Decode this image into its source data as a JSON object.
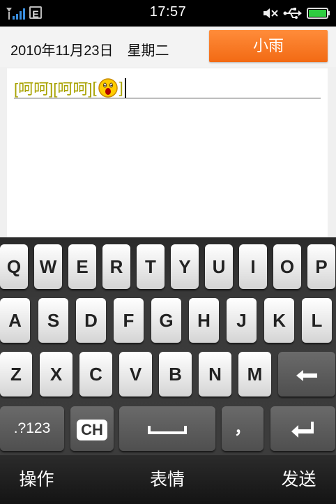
{
  "status_bar": {
    "time": "17:57",
    "network_label": "E",
    "icons": [
      "signal-icon",
      "network-e-icon",
      "mute-icon",
      "usb-icon",
      "battery-icon"
    ],
    "battery_color": "#2ecc40"
  },
  "header": {
    "date": "2010年11月23日　星期二",
    "recipient": "小雨",
    "recipient_color": "#f26a14"
  },
  "compose": {
    "tokens": [
      "[呵呵]",
      "[呵呵]",
      "["
    ],
    "trailing_bracket": "]",
    "emoji": "surprised-face-emoji",
    "text_color": "#a8a200"
  },
  "keyboard": {
    "row1": [
      "Q",
      "W",
      "E",
      "R",
      "T",
      "Y",
      "U",
      "I",
      "O",
      "P"
    ],
    "row2": [
      "A",
      "S",
      "D",
      "F",
      "G",
      "H",
      "J",
      "K",
      "L"
    ],
    "row3": [
      "Z",
      "X",
      "C",
      "V",
      "B",
      "N",
      "M"
    ],
    "backspace_icon": "backspace-arrow-icon",
    "symbols_label": ".?123",
    "lang_label": "CH",
    "space_icon": "space-bar-icon",
    "comma_label": "，",
    "enter_icon": "enter-icon"
  },
  "bottom_bar": {
    "left": "操作",
    "center": "表情",
    "right": "发送"
  }
}
